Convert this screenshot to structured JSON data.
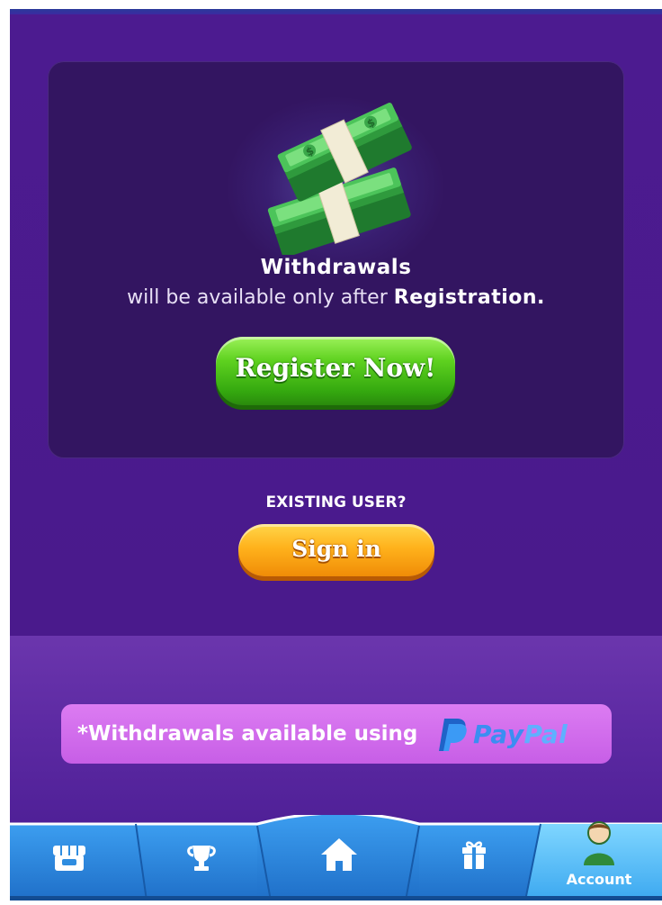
{
  "card": {
    "title": "Withdrawals",
    "subtitle_prefix": "will be available only after",
    "subtitle_strong": "Registration."
  },
  "buttons": {
    "register": "Register Now!",
    "signin": "Sign in"
  },
  "existing_user": "EXISTING USER?",
  "paypal_bar": {
    "text": "*Withdrawals available using",
    "logo_pay": "Pay",
    "logo_pal": "Pal"
  },
  "nav": {
    "active": "account",
    "items": [
      {
        "id": "shop",
        "icon": "shop-icon"
      },
      {
        "id": "trophy",
        "icon": "trophy-icon"
      },
      {
        "id": "home",
        "icon": "home-icon"
      },
      {
        "id": "gift",
        "icon": "gift-icon"
      },
      {
        "id": "account",
        "icon": "account-icon",
        "label": "Account"
      }
    ]
  },
  "colors": {
    "background": "#4a1a8c",
    "card": "#331561",
    "register_button": "#4fc41a",
    "signin_button": "#ffa51a",
    "paypal_bar": "#d26cee",
    "nav_bar": "#2f8de0",
    "nav_active": "#54c0ff"
  }
}
